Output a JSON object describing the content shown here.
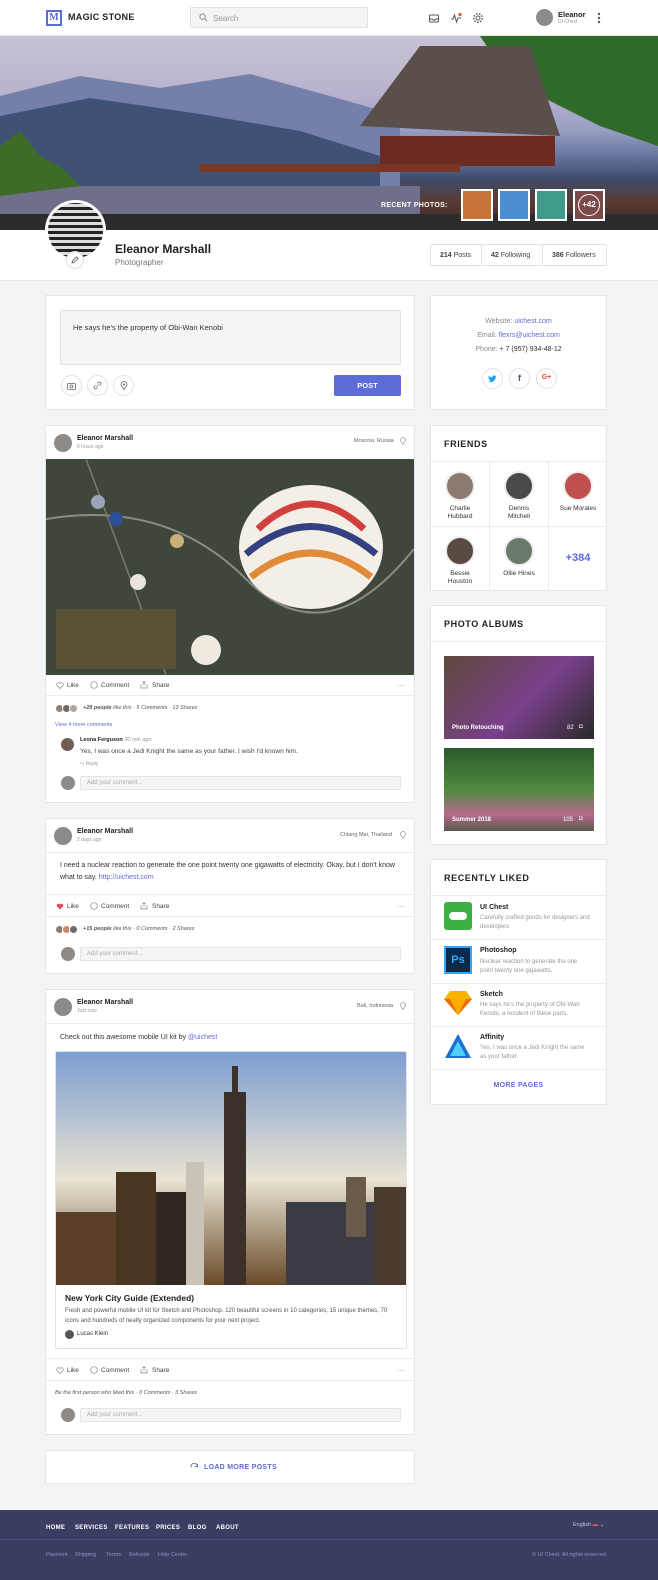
{
  "brand": {
    "logo_letter": "M",
    "name": "MAGIC STONE",
    "accent": "#5c6bd6"
  },
  "search": {
    "placeholder": "Search"
  },
  "user": {
    "name": "Eleanor",
    "role": "UI Chest"
  },
  "profile": {
    "recent_photos_label": "RECENT PHOTOS:",
    "more_photos": "+42",
    "name": "Eleanor Marshall",
    "title": "Photographer",
    "stats": [
      {
        "count": "214",
        "label": "Posts"
      },
      {
        "count": "42",
        "label": "Following"
      },
      {
        "count": "386",
        "label": "Followers"
      }
    ]
  },
  "composer": {
    "text": "He says he's the property of Obi-Wan Kenobi",
    "post_button": "POST"
  },
  "contact": {
    "website_label": "Website:",
    "website": "uichest.com",
    "email_label": "Email:",
    "email": "flexrs@uichest.com",
    "phone_label": "Phone:",
    "phone": "+ 7 (957) 934-48-12",
    "social": [
      "twitter-icon",
      "facebook-icon",
      "google-plus-icon"
    ]
  },
  "friends": {
    "title": "FRIENDS",
    "items": [
      {
        "name1": "Charlie",
        "name2": "Hubbard"
      },
      {
        "name1": "Dennis",
        "name2": "Mitchell"
      },
      {
        "name1": "Sue Morales",
        "name2": ""
      },
      {
        "name1": "Bessie",
        "name2": "Houston"
      },
      {
        "name1": "Ollie Hines",
        "name2": ""
      }
    ],
    "more": "+384"
  },
  "albums": {
    "title": "PHOTO ALBUMS",
    "items": [
      {
        "name": "Photo Retouching",
        "count": "82"
      },
      {
        "name": "Summer 2018",
        "count": "105"
      }
    ]
  },
  "liked": {
    "title": "RECENTLY LIKED",
    "items": [
      {
        "title": "UI Chest",
        "desc": "Carefully crafted goods for designers and developers",
        "color": "#3cb043"
      },
      {
        "title": "Photoshop",
        "desc": "Nuclear reaction to generate the one point twenty one gigawatts.",
        "color": "#0b2a4a"
      },
      {
        "title": "Sketch",
        "desc": "He says he's the property of Obi-Wan Kenobi, a resident of these parts.",
        "color": "#f7b500"
      },
      {
        "title": "Affinity",
        "desc": "Yes, I was once a Jedi Knight the same as your father.",
        "color": "#1c6fd1"
      }
    ],
    "more": "MORE PAGES"
  },
  "actions": {
    "like": "Like",
    "comment": "Comment",
    "share": "Share"
  },
  "posts": [
    {
      "author": "Eleanor Marshall",
      "time": "6 hours ago",
      "location": "Moscow, Russia",
      "likes_people": "+28 people",
      "likes_suffix": "like this",
      "comments": "5 Comments",
      "shares": "13 Shares",
      "view_more": "View 4 more comments",
      "comment": {
        "author": "Leona Ferguson",
        "time": "30 min ago",
        "text": "Yes, I was once a Jedi Knight the same as your father. I wish I'd known him.",
        "reply": "Reply"
      },
      "input_placeholder": "Add your comment..."
    },
    {
      "author": "Eleanor Marshall",
      "time": "2 days ago",
      "location": "Chiang Mai, Thailand",
      "text": "I need a nuclear reaction to generate the one point twenty one gigawatts of electricity. Okay, but I don't know what to say.",
      "link": "http://uichest.com",
      "likes_people": "+15 people",
      "likes_suffix": "like this",
      "comments": "0 Comments",
      "shares": "2 Shares",
      "input_placeholder": "Add your comment..."
    },
    {
      "author": "Eleanor Marshall",
      "time": "Just now",
      "location": "Bali, Indonesia",
      "text": "Check out this awesome mobile UI kit by",
      "mention": "@uichest",
      "link_card": {
        "title": "New York City Guide (Extended)",
        "desc": "Fresh and powerful mobile UI kit for Sketch and Photoshop. 120 beautiful screens in 10 categories, 15 unique themes, 70 icons and hundreds of neatly organized components for your next project.",
        "author": "Lucas Klein"
      },
      "likes_line": "Be the first person who liked this",
      "comments": "0 Comments",
      "shares": "3 Shares",
      "input_placeholder": "Add your comment..."
    }
  ],
  "load_more": "LOAD MORE POSTS",
  "footer": {
    "links": [
      "HOME",
      "SERVICES",
      "FEATURES",
      "PRICES",
      "BLOG",
      "ABOUT"
    ],
    "language": "English",
    "sub_links": [
      "Payment",
      "Shipping",
      "Terms",
      "Refunds",
      "Help Center"
    ],
    "copyright": "© UI Chest. All rights reserved."
  }
}
